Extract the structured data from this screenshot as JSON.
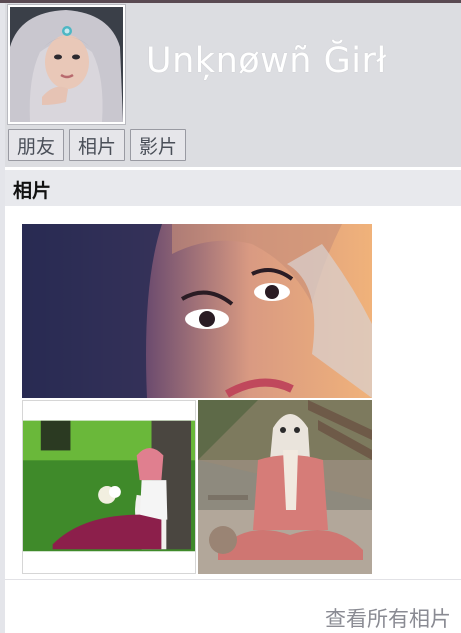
{
  "profile": {
    "name": "Unķnøwñ Ğirł"
  },
  "nav": [
    {
      "label": "朋友"
    },
    {
      "label": "相片"
    },
    {
      "label": "影片"
    }
  ],
  "photos_section": {
    "title": "相片",
    "see_all_label": "查看所有相片"
  },
  "colors": {
    "header_bg": "#dcdde1",
    "section_bg": "#e8e9ed",
    "name_text": "#ffffff",
    "link_text": "#8a8b93"
  }
}
